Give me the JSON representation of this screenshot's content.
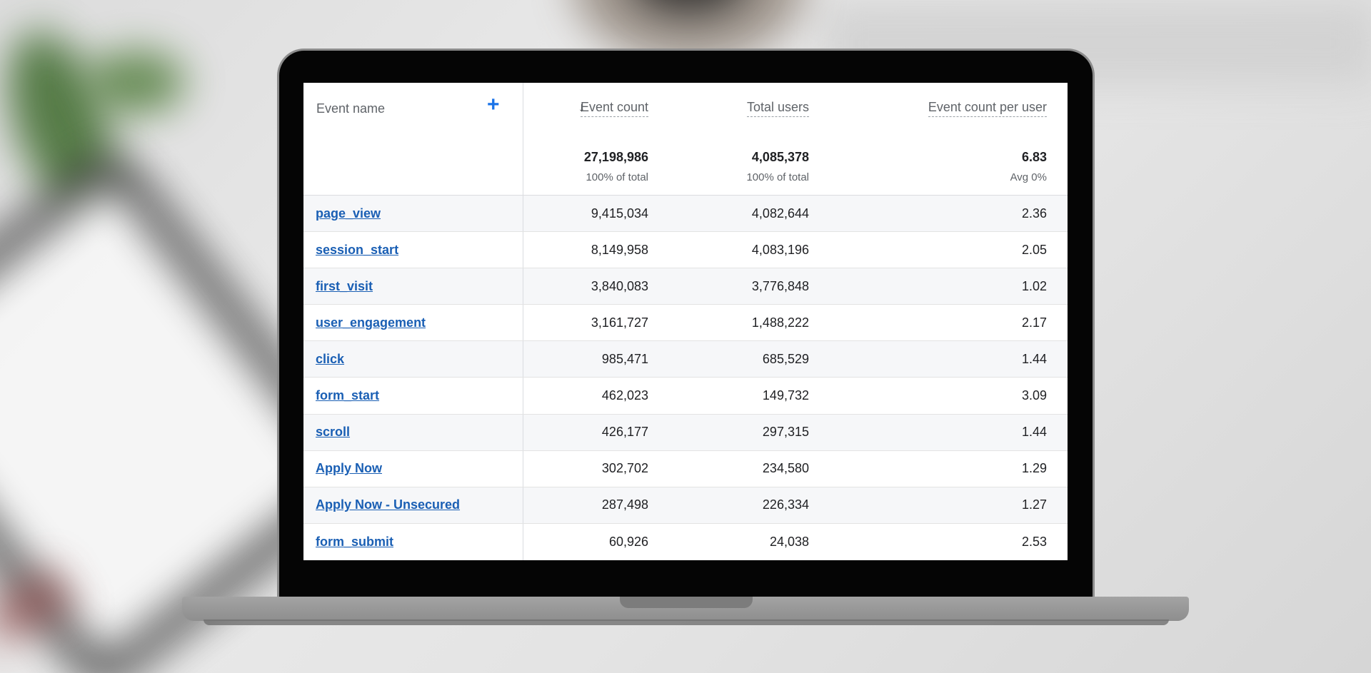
{
  "table": {
    "columns": {
      "event_name": "Event name",
      "event_count": "Event count",
      "total_users": "Total users",
      "per_user": "Event count per user"
    },
    "totals": {
      "event_count": "27,198,986",
      "event_count_pct": "100% of total",
      "total_users": "4,085,378",
      "total_users_pct": "100% of total",
      "per_user": "6.83",
      "per_user_pct": "Avg 0%"
    },
    "rows": [
      {
        "name": "page_view",
        "count": "9,415,034",
        "users": "4,082,644",
        "per_user": "2.36"
      },
      {
        "name": "session_start",
        "count": "8,149,958",
        "users": "4,083,196",
        "per_user": "2.05"
      },
      {
        "name": "first_visit",
        "count": "3,840,083",
        "users": "3,776,848",
        "per_user": "1.02"
      },
      {
        "name": "user_engagement",
        "count": "3,161,727",
        "users": "1,488,222",
        "per_user": "2.17"
      },
      {
        "name": "click",
        "count": "985,471",
        "users": "685,529",
        "per_user": "1.44"
      },
      {
        "name": "form_start",
        "count": "462,023",
        "users": "149,732",
        "per_user": "3.09"
      },
      {
        "name": "scroll",
        "count": "426,177",
        "users": "297,315",
        "per_user": "1.44"
      },
      {
        "name": "Apply Now",
        "count": "302,702",
        "users": "234,580",
        "per_user": "1.29"
      },
      {
        "name": "Apply Now - Unsecured",
        "count": "287,498",
        "users": "226,334",
        "per_user": "1.27"
      },
      {
        "name": "form_submit",
        "count": "60,926",
        "users": "24,038",
        "per_user": "2.53"
      }
    ]
  },
  "icons": {
    "add": "plus-icon",
    "sort": "arrow-down-icon"
  },
  "colors": {
    "link": "#1a5fb4",
    "accent": "#1a73e8",
    "row_alt": "#f6f7f9"
  }
}
